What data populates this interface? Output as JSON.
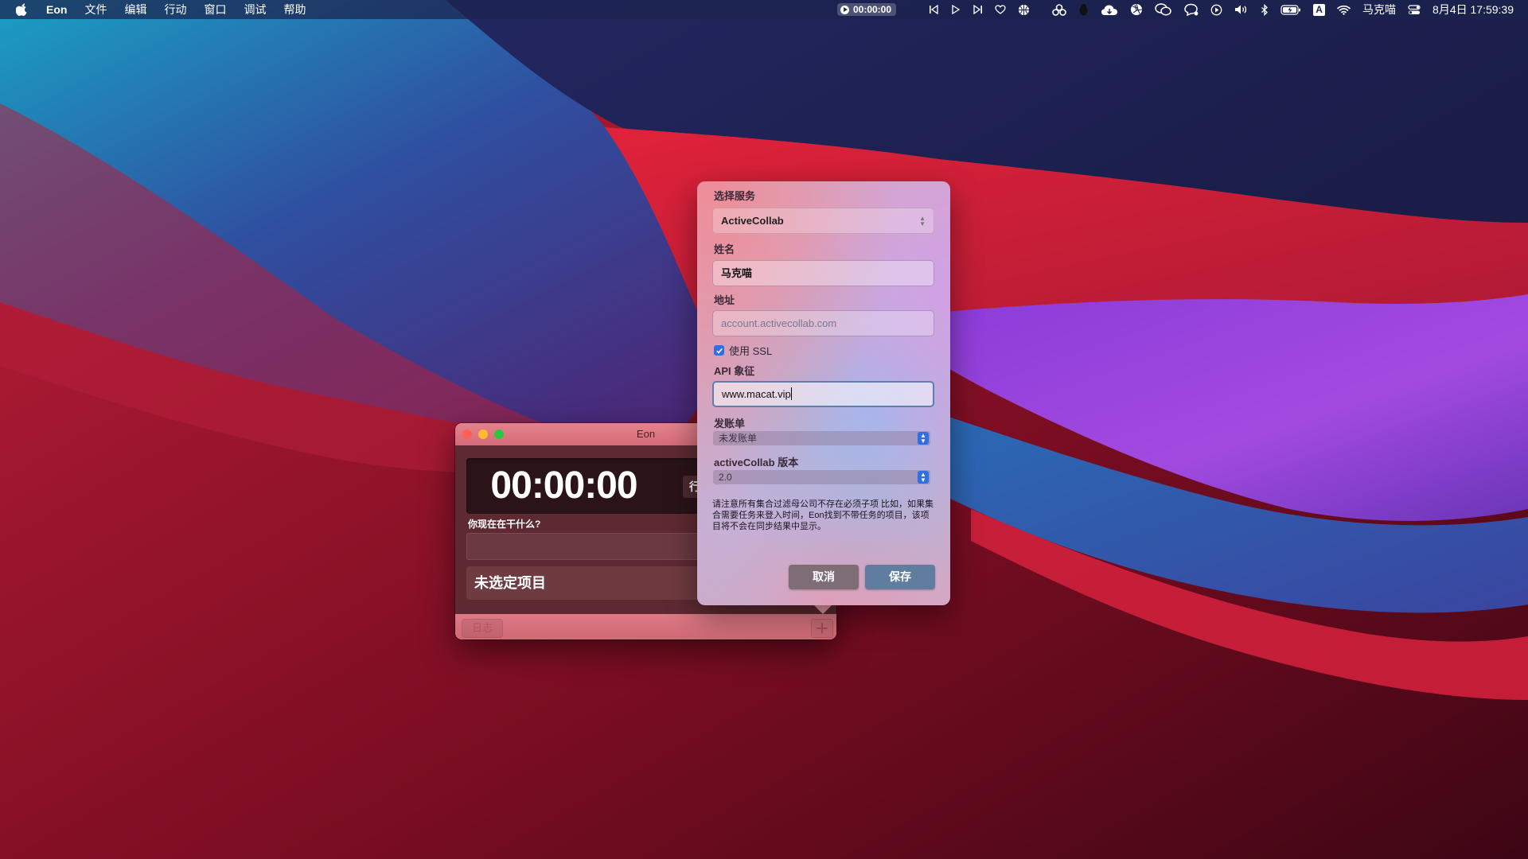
{
  "menubar": {
    "app_name": "Eon",
    "menus": [
      "文件",
      "编辑",
      "行动",
      "窗口",
      "调试",
      "帮助"
    ],
    "timer": "00:00:00",
    "user": "马克喵",
    "datetime": "8月4日  17:59:39",
    "status_icons": [
      "previous-track-icon",
      "play-icon",
      "next-track-icon",
      "heart-icon",
      "basketball-icon",
      "cluster-icon",
      "penguin-icon",
      "cloud-icon",
      "aperture-icon",
      "wechat-icon",
      "chat-bubble-icon",
      "play-circle-icon",
      "volume-icon",
      "bluetooth-icon",
      "battery-icon",
      "input-source-icon",
      "wifi-icon",
      "control-center-icon"
    ],
    "input_source_letter": "A"
  },
  "eon_window": {
    "title": "Eon",
    "timer": "00:00:00",
    "action_button": "行",
    "doing_label": "你现在在干什么?",
    "project": "未选定项目",
    "log_button": "日志"
  },
  "settings": {
    "service_label": "选择服务",
    "service_value": "ActiveCollab",
    "name_label": "姓名",
    "name_value": "马克喵",
    "address_label": "地址",
    "address_placeholder": "account.activecollab.com",
    "ssl_label": "使用 SSL",
    "ssl_checked": true,
    "api_label": "API 象征",
    "api_value": "www.macat.vip",
    "billing_label": "发账单",
    "billing_value": "未发账单",
    "version_label": "activeCollab 版本",
    "version_value": "2.0",
    "note": "请注意所有集合过滤母公司不存在必须子项  比如，如果集合需要任务来登入时间，Eon找到不带任务的项目，该项目将不会在同步结果中显示。",
    "cancel_label": "取消",
    "save_label": "保存"
  },
  "colors": {
    "accent_blue": "#2f6fe5",
    "eon_titlebar": "#d46c78",
    "timer_background": "#2b1418",
    "save_button": "#607c9e",
    "cancel_button": "#7f6d76"
  }
}
